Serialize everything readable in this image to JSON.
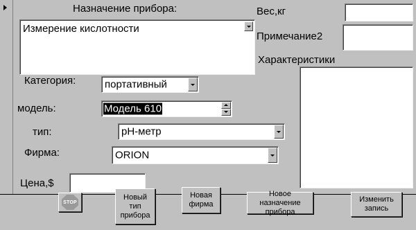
{
  "form": {
    "purpose_label": "Назначение прибора:",
    "purpose_value": "Измерение кислотности",
    "weight_label": "Вес,кг",
    "weight_value": "",
    "note2_label": "Примечание2",
    "note2_value": "",
    "characteristics_label": "Характеристики",
    "characteristics_value": "",
    "category_label": "Категория:",
    "category_value": "портативный",
    "model_label": "модель:",
    "model_value": "Модель 610",
    "type_label": "тип:",
    "type_value": "рН-метр",
    "firm_label": "Фирма:",
    "firm_value": "ORION",
    "price_label": "Цена,$",
    "price_value": ""
  },
  "buttons": {
    "stop_label": "STOP",
    "new_type": "Новый\nтип\nприбора",
    "new_firm": "Новая\nфирма",
    "new_purpose": "Новое назначение\nприбора",
    "edit_record": "Изменить\nзапись"
  },
  "icons": {
    "record_selector": "triangle-right-icon",
    "stop": "stop-sign-icon",
    "dropdown": "chevron-down-icon",
    "spin_up": "spin-up-icon",
    "spin_down": "spin-down-icon"
  }
}
